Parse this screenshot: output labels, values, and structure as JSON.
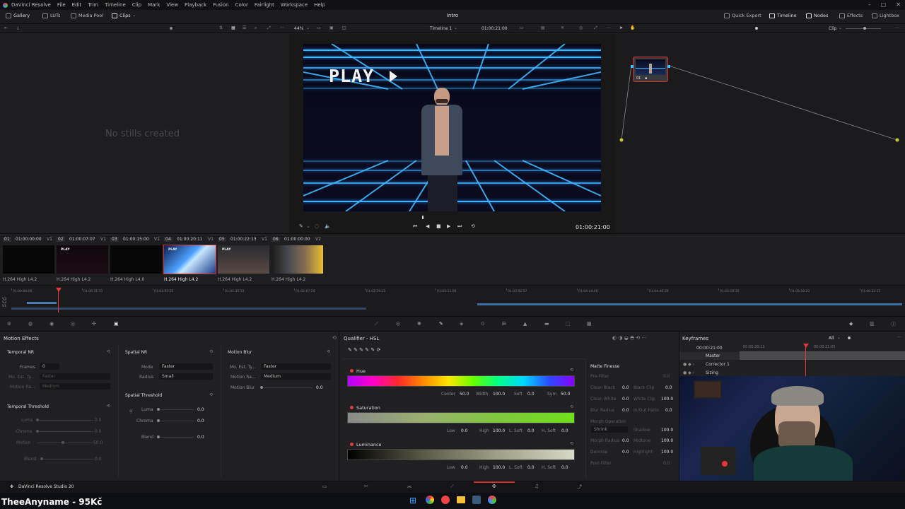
{
  "menubar": {
    "app": "DaVinci Resolve",
    "items": [
      "File",
      "Edit",
      "Trim",
      "Timeline",
      "Clip",
      "Mark",
      "View",
      "Playback",
      "Fusion",
      "Color",
      "Fairlight",
      "Workspace",
      "Help"
    ]
  },
  "toolbar": {
    "gallery": "Gallery",
    "luts": "LUTs",
    "media_pool": "Media Pool",
    "clips": "Clips",
    "project_title": "Intro",
    "quick_export": "Quick Export",
    "timeline": "Timeline",
    "nodes": "Nodes",
    "effects": "Effects",
    "lightbox": "Lightbox"
  },
  "subtoolbar": {
    "zoom": "44%",
    "timeline_name": "Timeline 1",
    "timecode": "01:00:21:00",
    "clip_mode": "Clip"
  },
  "gallery": {
    "empty_text": "No stills created"
  },
  "viewer": {
    "overlay_text": "PLAY",
    "timecode": "01:00:21:00"
  },
  "node": {
    "label": "01"
  },
  "clips": [
    {
      "num": "01",
      "tc": "01:00:00:00",
      "track": "V1",
      "name": "H.264 High L4.2"
    },
    {
      "num": "02",
      "tc": "01:00:07:07",
      "track": "V1",
      "name": "H.264 High L4.2"
    },
    {
      "num": "03",
      "tc": "01:00:15:00",
      "track": "V1",
      "name": "H.264 High L4.0"
    },
    {
      "num": "04",
      "tc": "01:00:20:11",
      "track": "V1",
      "name": "H.264 High L4.2"
    },
    {
      "num": "05",
      "tc": "01:00:22:13",
      "track": "V1",
      "name": "H.264 High L4.2"
    },
    {
      "num": "06",
      "tc": "01:00:00:00",
      "track": "V2",
      "name": "H.264 High L4.2"
    }
  ],
  "mini_timeline": {
    "ruler": [
      "01:00:00:00",
      "01:00:31:31",
      "01:01:03:02",
      "01:01:35:33",
      "01:02:07:24",
      "01:02:39:15",
      "01:03:11:06",
      "01:03:42:57",
      "01:04:14:48",
      "01:04:46:39",
      "01:05:18:30",
      "01:05:50:21",
      "01:06:22:12"
    ],
    "tracks": [
      "V3",
      "V2",
      "V1"
    ]
  },
  "motion_effects": {
    "title": "Motion Effects",
    "temporal_nr": {
      "title": "Temporal NR",
      "frames_label": "Frames",
      "frames_value": "0",
      "mo_est_label": "Mo. Est. Ty...",
      "mo_est_value": "Faster",
      "motion_range_label": "Motion Ra...",
      "motion_range_value": "Medium"
    },
    "temporal_threshold": {
      "title": "Temporal Threshold",
      "luma": "Luma",
      "luma_value": "0.0",
      "chroma": "Chroma",
      "chroma_value": "0.0",
      "motion": "Motion",
      "motion_value": "50.0",
      "blend": "Blend",
      "blend_value": "0.0"
    },
    "spatial_nr": {
      "title": "Spatial NR",
      "mode_label": "Mode",
      "mode_value": "Faster",
      "radius_label": "Radius",
      "radius_value": "Small"
    },
    "spatial_threshold": {
      "title": "Spatial Threshold",
      "luma": "Luma",
      "luma_value": "0.0",
      "chroma": "Chroma",
      "chroma_value": "0.0",
      "blend": "Blend",
      "blend_value": "0.0"
    },
    "motion_blur": {
      "title": "Motion Blur",
      "mo_est_label": "Mo. Est. Ty...",
      "mo_est_value": "Faster",
      "motion_range_label": "Motion Ra...",
      "motion_range_value": "Medium",
      "blur_label": "Motion Blur",
      "blur_value": "0.0"
    }
  },
  "qualifier": {
    "title": "Qualifier - HSL",
    "hue": {
      "label": "Hue",
      "center": "Center",
      "center_value": "50.0",
      "width": "Width",
      "width_value": "100.0",
      "soft": "Soft",
      "soft_value": "0.0",
      "sym": "Sym",
      "sym_value": "50.0"
    },
    "saturation": {
      "label": "Saturation",
      "low": "Low",
      "low_value": "0.0",
      "high": "High",
      "high_value": "100.0",
      "lsoft": "L. Soft",
      "lsoft_value": "0.0",
      "hsoft": "H. Soft",
      "hsoft_value": "0.0"
    },
    "luminance": {
      "label": "Luminance",
      "low": "Low",
      "low_value": "0.0",
      "high": "High",
      "high_value": "100.0",
      "lsoft": "L. Soft",
      "lsoft_value": "0.0",
      "hsoft": "H. Soft",
      "hsoft_value": "0.0"
    },
    "matte_finesse": {
      "title": "Matte Finesse",
      "pre_filter": "Pre-Filter",
      "clean_black": "Clean Black",
      "clean_black_value": "0.0",
      "black_clip": "Black Clip",
      "black_clip_value": "0.0",
      "clean_white": "Clean White",
      "clean_white_value": "0.0",
      "white_clip": "White Clip",
      "white_clip_value": "100.0",
      "blur_radius": "Blur Radius",
      "blur_radius_value": "0.0",
      "in_out_ratio": "In/Out Ratio",
      "in_out_ratio_value": "0.0",
      "morph_op": "Morph Operation",
      "morph_op_value": "Shrink",
      "shadow": "Shadow",
      "shadow_value": "100.0",
      "morph_radius": "Morph Radius",
      "morph_radius_value": "0.0",
      "midtone": "Midtone",
      "midtone_value": "100.0",
      "denoise": "Denoise",
      "denoise_value": "0.0",
      "highlight": "Highlight",
      "highlight_value": "100.0",
      "post_filter": "Post-Filter"
    }
  },
  "keyframes": {
    "title": "Keyframes",
    "filter": "All",
    "timecode": "00:00:21:00",
    "ruler": [
      "00:00:20:11",
      "00:00:21:05"
    ],
    "rows": [
      "Master",
      "Corrector 1",
      "Sizing"
    ]
  },
  "pagebar": {
    "brand": "DaVinci Resolve Studio 20"
  },
  "webcam_caption": "TheeAnyname - 95Kč",
  "colors": {
    "accent_red": "#e03a3a",
    "neon_blue": "#3fb7ff",
    "selection_red": "#d0302b"
  }
}
